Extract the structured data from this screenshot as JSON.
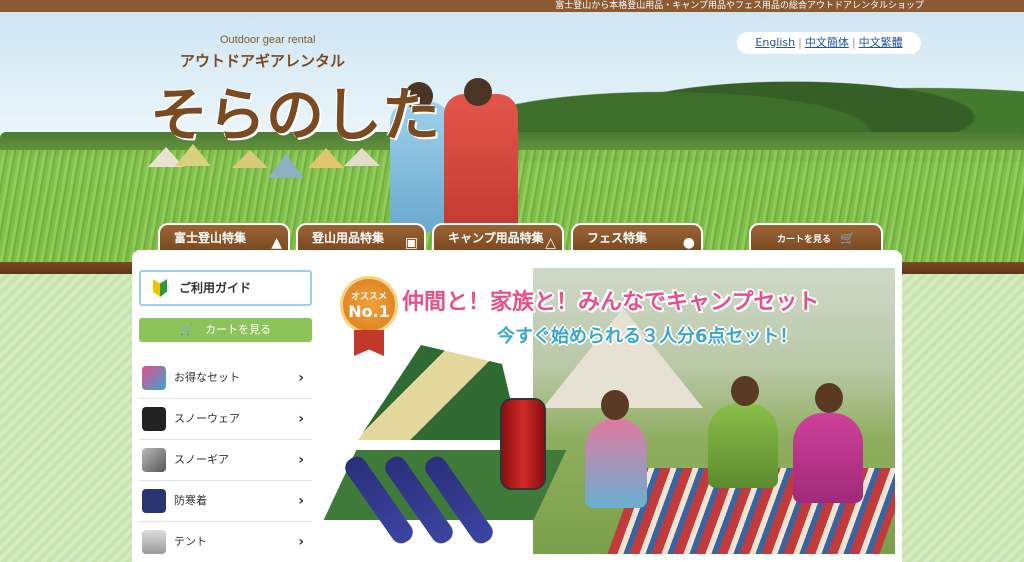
{
  "top_bar": {
    "tagline": "富士登山から本格登山用品・キャンプ用品やフェス用品の総合アウトドアレンタルショップ"
  },
  "logo": {
    "sub": "Outdoor gear rental",
    "kana": "アウトドアギアレンタル",
    "main": "そらのした"
  },
  "languages": [
    "English",
    "中文簡体",
    "中文繁體"
  ],
  "nav": {
    "tabs": [
      {
        "label": "富士登山特集",
        "icon": "mountain-icon"
      },
      {
        "label": "登山用品特集",
        "icon": "backpack-icon"
      },
      {
        "label": "キャンプ用品特集",
        "icon": "tent-icon"
      },
      {
        "label": "フェス特集",
        "icon": "balloon-icon"
      }
    ],
    "cart_label": "カートを見る"
  },
  "sidebar": {
    "guide_label": "ご利用ガイド",
    "cart_label": "カートを見る",
    "categories": [
      {
        "label": "お得なセット"
      },
      {
        "label": "スノーウェア"
      },
      {
        "label": "スノーギア"
      },
      {
        "label": "防寒着"
      },
      {
        "label": "テント"
      }
    ]
  },
  "banner": {
    "badge_top": "オススメ",
    "badge_main": "No.1",
    "headline": "仲間と！家族と！みんなでキャンプセット",
    "subhead": "今すぐ始められる３人分6点セット！"
  },
  "colors": {
    "brown": "#7a4a22",
    "green": "#8cc45a",
    "pink": "#e8508a",
    "cyan": "#3aa7c8"
  }
}
